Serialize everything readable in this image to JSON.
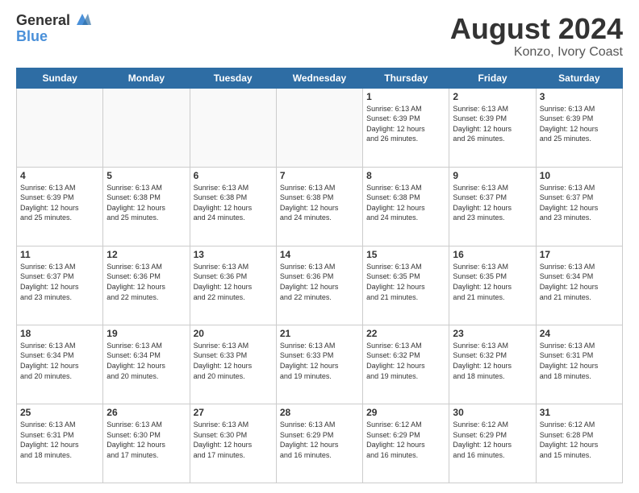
{
  "header": {
    "logo_general": "General",
    "logo_blue": "Blue",
    "month_title": "August 2024",
    "location": "Konzo, Ivory Coast"
  },
  "days_of_week": [
    "Sunday",
    "Monday",
    "Tuesday",
    "Wednesday",
    "Thursday",
    "Friday",
    "Saturday"
  ],
  "weeks": [
    [
      {
        "day": "",
        "info": ""
      },
      {
        "day": "",
        "info": ""
      },
      {
        "day": "",
        "info": ""
      },
      {
        "day": "",
        "info": ""
      },
      {
        "day": "1",
        "info": "Sunrise: 6:13 AM\nSunset: 6:39 PM\nDaylight: 12 hours\nand 26 minutes."
      },
      {
        "day": "2",
        "info": "Sunrise: 6:13 AM\nSunset: 6:39 PM\nDaylight: 12 hours\nand 26 minutes."
      },
      {
        "day": "3",
        "info": "Sunrise: 6:13 AM\nSunset: 6:39 PM\nDaylight: 12 hours\nand 25 minutes."
      }
    ],
    [
      {
        "day": "4",
        "info": "Sunrise: 6:13 AM\nSunset: 6:39 PM\nDaylight: 12 hours\nand 25 minutes."
      },
      {
        "day": "5",
        "info": "Sunrise: 6:13 AM\nSunset: 6:38 PM\nDaylight: 12 hours\nand 25 minutes."
      },
      {
        "day": "6",
        "info": "Sunrise: 6:13 AM\nSunset: 6:38 PM\nDaylight: 12 hours\nand 24 minutes."
      },
      {
        "day": "7",
        "info": "Sunrise: 6:13 AM\nSunset: 6:38 PM\nDaylight: 12 hours\nand 24 minutes."
      },
      {
        "day": "8",
        "info": "Sunrise: 6:13 AM\nSunset: 6:38 PM\nDaylight: 12 hours\nand 24 minutes."
      },
      {
        "day": "9",
        "info": "Sunrise: 6:13 AM\nSunset: 6:37 PM\nDaylight: 12 hours\nand 23 minutes."
      },
      {
        "day": "10",
        "info": "Sunrise: 6:13 AM\nSunset: 6:37 PM\nDaylight: 12 hours\nand 23 minutes."
      }
    ],
    [
      {
        "day": "11",
        "info": "Sunrise: 6:13 AM\nSunset: 6:37 PM\nDaylight: 12 hours\nand 23 minutes."
      },
      {
        "day": "12",
        "info": "Sunrise: 6:13 AM\nSunset: 6:36 PM\nDaylight: 12 hours\nand 22 minutes."
      },
      {
        "day": "13",
        "info": "Sunrise: 6:13 AM\nSunset: 6:36 PM\nDaylight: 12 hours\nand 22 minutes."
      },
      {
        "day": "14",
        "info": "Sunrise: 6:13 AM\nSunset: 6:36 PM\nDaylight: 12 hours\nand 22 minutes."
      },
      {
        "day": "15",
        "info": "Sunrise: 6:13 AM\nSunset: 6:35 PM\nDaylight: 12 hours\nand 21 minutes."
      },
      {
        "day": "16",
        "info": "Sunrise: 6:13 AM\nSunset: 6:35 PM\nDaylight: 12 hours\nand 21 minutes."
      },
      {
        "day": "17",
        "info": "Sunrise: 6:13 AM\nSunset: 6:34 PM\nDaylight: 12 hours\nand 21 minutes."
      }
    ],
    [
      {
        "day": "18",
        "info": "Sunrise: 6:13 AM\nSunset: 6:34 PM\nDaylight: 12 hours\nand 20 minutes."
      },
      {
        "day": "19",
        "info": "Sunrise: 6:13 AM\nSunset: 6:34 PM\nDaylight: 12 hours\nand 20 minutes."
      },
      {
        "day": "20",
        "info": "Sunrise: 6:13 AM\nSunset: 6:33 PM\nDaylight: 12 hours\nand 20 minutes."
      },
      {
        "day": "21",
        "info": "Sunrise: 6:13 AM\nSunset: 6:33 PM\nDaylight: 12 hours\nand 19 minutes."
      },
      {
        "day": "22",
        "info": "Sunrise: 6:13 AM\nSunset: 6:32 PM\nDaylight: 12 hours\nand 19 minutes."
      },
      {
        "day": "23",
        "info": "Sunrise: 6:13 AM\nSunset: 6:32 PM\nDaylight: 12 hours\nand 18 minutes."
      },
      {
        "day": "24",
        "info": "Sunrise: 6:13 AM\nSunset: 6:31 PM\nDaylight: 12 hours\nand 18 minutes."
      }
    ],
    [
      {
        "day": "25",
        "info": "Sunrise: 6:13 AM\nSunset: 6:31 PM\nDaylight: 12 hours\nand 18 minutes."
      },
      {
        "day": "26",
        "info": "Sunrise: 6:13 AM\nSunset: 6:30 PM\nDaylight: 12 hours\nand 17 minutes."
      },
      {
        "day": "27",
        "info": "Sunrise: 6:13 AM\nSunset: 6:30 PM\nDaylight: 12 hours\nand 17 minutes."
      },
      {
        "day": "28",
        "info": "Sunrise: 6:13 AM\nSunset: 6:29 PM\nDaylight: 12 hours\nand 16 minutes."
      },
      {
        "day": "29",
        "info": "Sunrise: 6:12 AM\nSunset: 6:29 PM\nDaylight: 12 hours\nand 16 minutes."
      },
      {
        "day": "30",
        "info": "Sunrise: 6:12 AM\nSunset: 6:29 PM\nDaylight: 12 hours\nand 16 minutes."
      },
      {
        "day": "31",
        "info": "Sunrise: 6:12 AM\nSunset: 6:28 PM\nDaylight: 12 hours\nand 15 minutes."
      }
    ]
  ]
}
